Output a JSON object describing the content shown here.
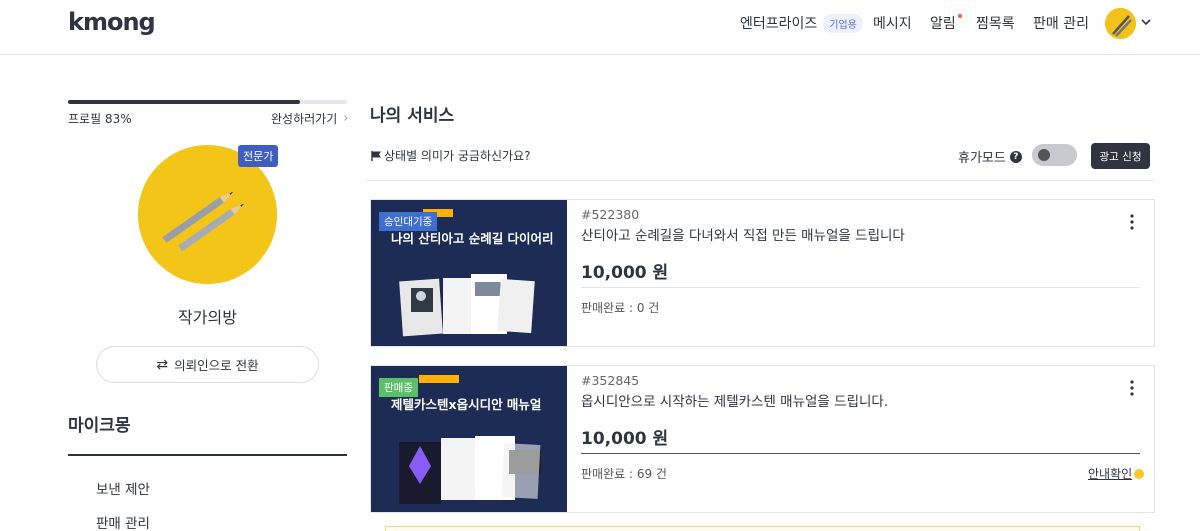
{
  "header": {
    "logo": "kmong",
    "nav": {
      "enterprise": "엔터프라이즈",
      "enterprise_badge": "기업용",
      "messages": "메시지",
      "alarms": "알림",
      "wishlist": "찜목록",
      "sales_manage": "판매 관리"
    }
  },
  "sidebar": {
    "profile_progress_label": "프로필 83%",
    "profile_progress": 0.83,
    "complete_link": "완성하러가기",
    "pro_badge": "전문가",
    "seller_name": "작가의방",
    "switch_button": "의뢰인으로 전환",
    "mykmong_title": "마이크몽",
    "menu": [
      "보낸 제안",
      "판매 관리"
    ]
  },
  "main": {
    "title": "나의 서비스",
    "status_help": "상태별 의미가 궁금하신가요?",
    "vacation_label": "휴가모드",
    "vacation_on": false,
    "ad_button": "광고 신청",
    "services": [
      {
        "status": "승인대기중",
        "thumb_title": "나의 산티아고 순례길 다이어리",
        "number": "#522380",
        "title": "산티아고 순례길을 다녀와서 직접 만든 매뉴얼을 드립니다",
        "price": "10,000 원",
        "sales": "판매완료 : 0 건"
      },
      {
        "status": "판매중",
        "thumb_title": "제텔카스텐x옵시디안 매뉴얼",
        "number": "#352845",
        "title": "옵시디안으로 시작하는 제텔카스텐 매뉴얼을 드립니다.",
        "price": "10,000 원",
        "sales": "판매완료 : 69 건",
        "info_link": "안내확인"
      }
    ]
  },
  "colors": {
    "primary_dark": "#303441",
    "pro_badge": "#3e5fbf",
    "status_pending": "#3e6ed0",
    "status_selling": "#5dbe6a",
    "profile_yellow": "#f4c519"
  }
}
